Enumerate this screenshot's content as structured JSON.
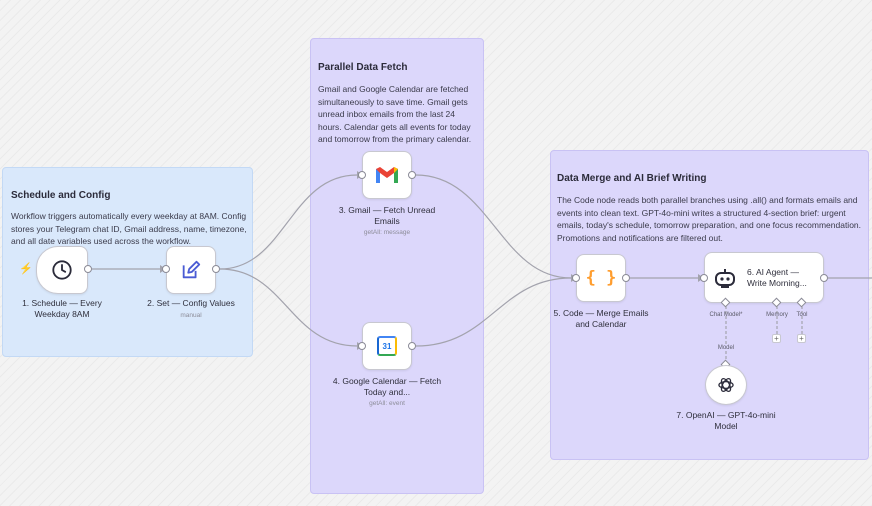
{
  "stickies": {
    "schedule": {
      "title": "Schedule and Config",
      "body": "Workflow triggers automatically every weekday at 8AM. Config stores your Telegram chat ID, Gmail address, name, timezone, and all date variables used across the workflow."
    },
    "parallel": {
      "title": "Parallel Data Fetch",
      "body": "Gmail and Google Calendar are fetched simultaneously to save time. Gmail gets unread inbox emails from the last 24 hours. Calendar gets all events for today and tomorrow from the primary calendar."
    },
    "merge": {
      "title": "Data Merge and AI Brief Writing",
      "body": "The Code node reads both parallel branches using .all() and formats emails and events into clean text. GPT-4o-mini writes a structured 4-section brief: urgent emails, today's schedule, tomorrow preparation, and one focus recommendation. Promotions and notifications are filtered out."
    }
  },
  "nodes": {
    "schedule": {
      "label": "1. Schedule — Every Weekday 8AM",
      "icon": "clock-icon"
    },
    "set": {
      "label": "2. Set — Config Values",
      "sub": "manual",
      "icon": "edit-icon"
    },
    "gmail": {
      "label": "3. Gmail — Fetch Unread Emails",
      "sub": "getAll: message",
      "icon": "gmail-icon"
    },
    "calendar": {
      "label": "4. Google Calendar — Fetch Today and...",
      "sub": "getAll: event",
      "icon": "google-calendar-icon",
      "icon_text": "31"
    },
    "code": {
      "label": "5. Code — Merge Emails and Calendar",
      "icon": "code-braces-icon",
      "icon_text": "{ }"
    },
    "agent": {
      "label": "6. AI Agent — Write Morning...",
      "icon": "robot-icon"
    },
    "openai": {
      "label": "7. OpenAI — GPT-4o-mini Model",
      "icon": "openai-icon"
    }
  },
  "agent_ports": {
    "chat_model": "Chat Model*",
    "memory": "Memory",
    "tool": "Tool"
  },
  "model_edge_label": "Model",
  "plus_symbol": "+",
  "colors": {
    "blue_sticky": "#d9e8fb",
    "purple_sticky": "#dcd7fb",
    "gmail_red": "#ea4335",
    "code_orange": "#ff9d2e",
    "trigger_bolt": "#ff6b2b"
  }
}
